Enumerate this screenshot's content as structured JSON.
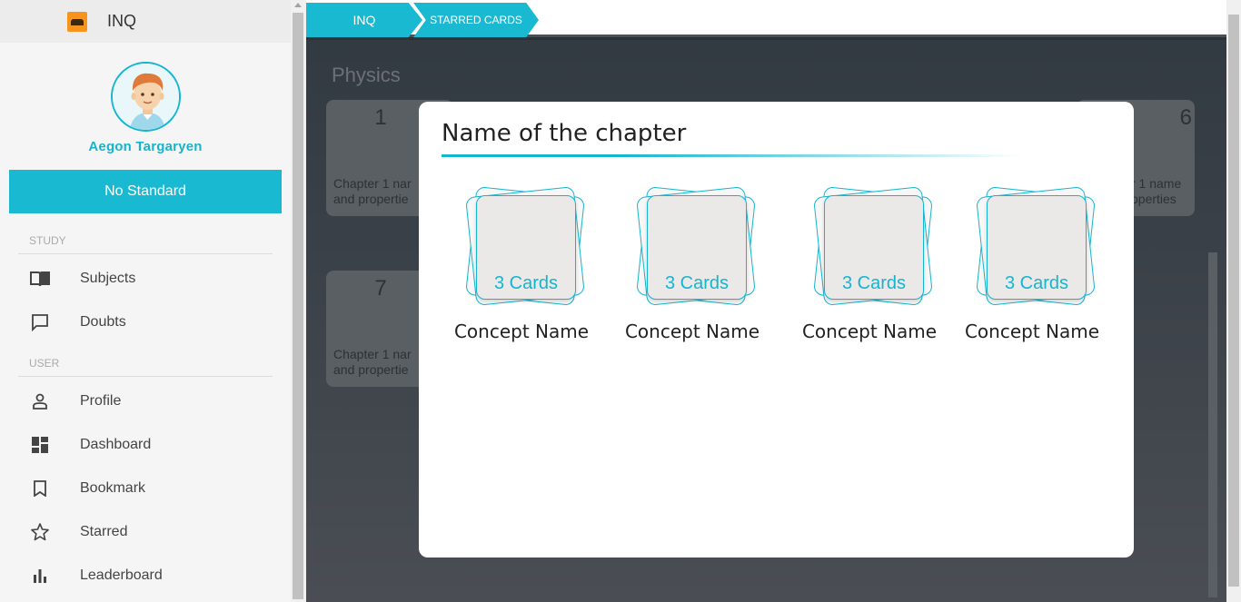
{
  "app": {
    "name": "INQ",
    "logo_icon": "inq-logo-icon"
  },
  "user": {
    "name": "Aegon Targaryen",
    "avatar_icon": "user-avatar-icon"
  },
  "standard_button": {
    "label": "No Standard"
  },
  "sidebar": {
    "sections": [
      {
        "label": "STUDY"
      },
      {
        "label": "USER"
      }
    ],
    "items": [
      {
        "label": "Subjects",
        "icon": "book-icon"
      },
      {
        "label": "Doubts",
        "icon": "chat-icon"
      },
      {
        "label": "Profile",
        "icon": "person-icon"
      },
      {
        "label": "Dashboard",
        "icon": "dashboard-icon"
      },
      {
        "label": "Bookmark",
        "icon": "bookmark-icon"
      },
      {
        "label": "Starred",
        "icon": "star-icon"
      },
      {
        "label": "Leaderboard",
        "icon": "bar-chart-icon"
      }
    ]
  },
  "breadcrumb": {
    "items": [
      {
        "label": "INQ"
      },
      {
        "label": "STARRED CARDS"
      }
    ]
  },
  "background": {
    "subject_title": "Physics",
    "chapters": [
      {
        "number": "1",
        "name_line1": "Chapter 1 nar",
        "name_line2": "and propertie"
      },
      {
        "number": "6",
        "name_line1": "r 1 name",
        "name_line2": "operties"
      },
      {
        "number": "7",
        "name_line1": "Chapter 1 nar",
        "name_line2": "and propertie"
      }
    ]
  },
  "modal": {
    "title": "Name of the chapter",
    "concepts": [
      {
        "cards_label": "3 Cards",
        "name": "Concept Name"
      },
      {
        "cards_label": "3 Cards",
        "name": "Concept Name"
      },
      {
        "cards_label": "3 Cards",
        "name": "Concept Name"
      },
      {
        "cards_label": "3 Cards",
        "name": "Concept Name"
      }
    ]
  },
  "colors": {
    "accent": "#19b9d2",
    "overlay": "#2c3137"
  }
}
